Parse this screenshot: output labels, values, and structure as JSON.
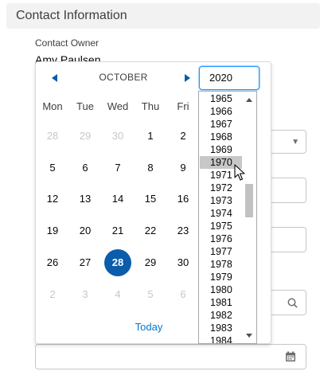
{
  "section": {
    "title": "Contact Information"
  },
  "owner": {
    "label": "Contact Owner",
    "value": "Amy Paulsen"
  },
  "datepicker": {
    "month": "OCTOBER",
    "year": "2020",
    "weekdays": [
      "Mon",
      "Tue",
      "Wed",
      "Thu",
      "Fri"
    ],
    "weeks": [
      [
        "28",
        "29",
        "30",
        "1",
        "2"
      ],
      [
        "5",
        "6",
        "7",
        "8",
        "9"
      ],
      [
        "12",
        "13",
        "14",
        "15",
        "16"
      ],
      [
        "19",
        "20",
        "21",
        "22",
        "23"
      ],
      [
        "26",
        "27",
        "28",
        "29",
        "30"
      ],
      [
        "2",
        "3",
        "4",
        "5",
        "6"
      ]
    ],
    "selected_day": "28",
    "today_label": "Today"
  },
  "year_dropdown": {
    "years": [
      "1965",
      "1966",
      "1967",
      "1968",
      "1969",
      "1970",
      "1971",
      "1972",
      "1973",
      "1974",
      "1975",
      "1976",
      "1977",
      "1978",
      "1979",
      "1980",
      "1981",
      "1982",
      "1983",
      "1984"
    ],
    "hovered_year": "1970"
  },
  "colors": {
    "accent": "#0b5cab",
    "link": "#0176d3",
    "focus": "#1b96ff"
  }
}
